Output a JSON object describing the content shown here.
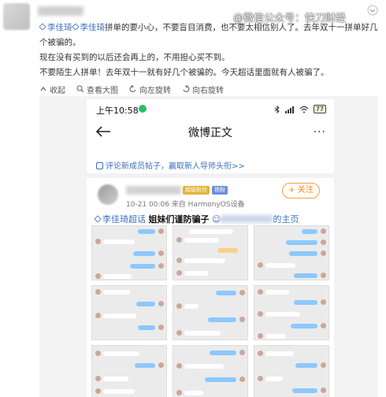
{
  "watermark": "@微信公众号：快刀财经",
  "post": {
    "topic_1": "李佳琦",
    "topic_2": "李佳琦",
    "line_1_text": "拼单的要小心，不要盲目消费，也不要太相信别人了。去年双十一拼单好几",
    "line_1_cont": "个被骗的。",
    "line_2": "现在没有买到的以后还会再上的，不用担心买不到。",
    "line_3": "不要陌生人拼单！去年双十一就有好几个被骗的。今天超话里面就有人被骗了。"
  },
  "toolbar": {
    "collapse_label": "收起",
    "view_large_label": "查看大图",
    "rotate_left_label": "向左旋转",
    "rotate_right_label": "向右旋转"
  },
  "phone": {
    "status_time": "上午10:58",
    "battery": "77",
    "nav_title": "微博正文",
    "more_label": "···",
    "notice": "评论新成员帖子，赢取新人导师头衔>>",
    "tag_1": "超级粉丝",
    "tag_2": "铁粉",
    "follow_label": "+ 关注",
    "meta": "10-21 00:06  来自 HarmonyOS设备",
    "headline_topic": "李佳琦超话",
    "headline_bold": "姐妹们谨防骗子",
    "headline_tail": "的主页"
  },
  "icons": {
    "chevron": "chevron-down-icon",
    "collapse": "collapse-icon",
    "view_large": "magnify-icon",
    "rotate_left": "rotate-left-icon",
    "rotate_right": "rotate-right-icon",
    "back": "back-arrow-icon"
  },
  "colors": {
    "link": "#3a6fbf",
    "follow": "#e88a1a",
    "bubble_self": "#8cc8ff"
  }
}
